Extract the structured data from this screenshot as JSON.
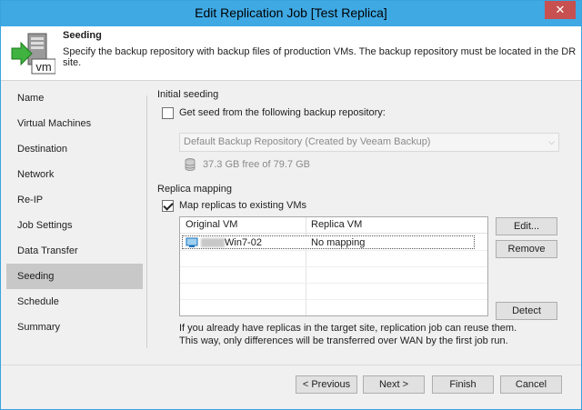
{
  "window": {
    "title": "Edit Replication Job [Test Replica]",
    "close": "✕"
  },
  "header": {
    "title": "Seeding",
    "description": "Specify the backup repository with backup files of production VMs. The backup repository must be located in the DR site.",
    "icon_text": "vm"
  },
  "nav": {
    "items": [
      {
        "label": "Name"
      },
      {
        "label": "Virtual Machines"
      },
      {
        "label": "Destination"
      },
      {
        "label": "Network"
      },
      {
        "label": "Re-IP"
      },
      {
        "label": "Job Settings"
      },
      {
        "label": "Data Transfer"
      },
      {
        "label": "Seeding",
        "active": true
      },
      {
        "label": "Schedule"
      },
      {
        "label": "Summary"
      }
    ]
  },
  "initial_seeding": {
    "group_label": "Initial seeding",
    "checkbox_label": "Get seed from the following backup repository:",
    "checked": false,
    "repository": "Default Backup Repository (Created by Veeam Backup)",
    "free_space": "37.3 GB free of 79.7 GB"
  },
  "replica_mapping": {
    "group_label": "Replica mapping",
    "checkbox_label": "Map replicas to existing VMs",
    "checked": true,
    "columns": [
      "Original VM",
      "Replica VM"
    ],
    "rows": [
      {
        "original": "Win7-02",
        "replica": "No mapping"
      }
    ],
    "buttons": {
      "edit": "Edit...",
      "remove": "Remove",
      "detect": "Detect"
    },
    "hint_line1": "If you already have replicas in the target site, replication job can reuse them.",
    "hint_line2": "This way, only differences will be transferred over WAN by the first job run."
  },
  "footer": {
    "previous": "< Previous",
    "next": "Next >",
    "finish": "Finish",
    "cancel": "Cancel"
  }
}
